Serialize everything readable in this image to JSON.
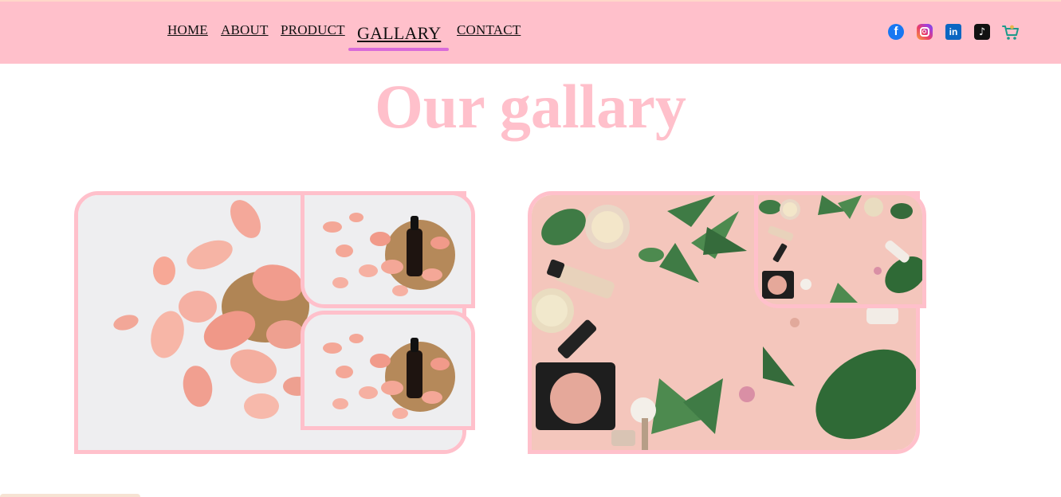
{
  "nav": {
    "links": [
      "HOME",
      "ABOUT",
      "PRODUCT",
      "GALLARY",
      "CONTACT"
    ],
    "active": "GALLARY"
  },
  "social": {
    "facebook": "f",
    "linkedin": "in",
    "tiktok": "♪",
    "icons": [
      "facebook-icon",
      "instagram-icon",
      "linkedin-icon",
      "tiktok-icon",
      "cart-icon"
    ]
  },
  "title": "Our gallary",
  "colors": {
    "navbar": "#ffc0cb",
    "title": "#ffc0cb",
    "frame": "#ffc0cb",
    "active_underline": "#d86ad9"
  }
}
